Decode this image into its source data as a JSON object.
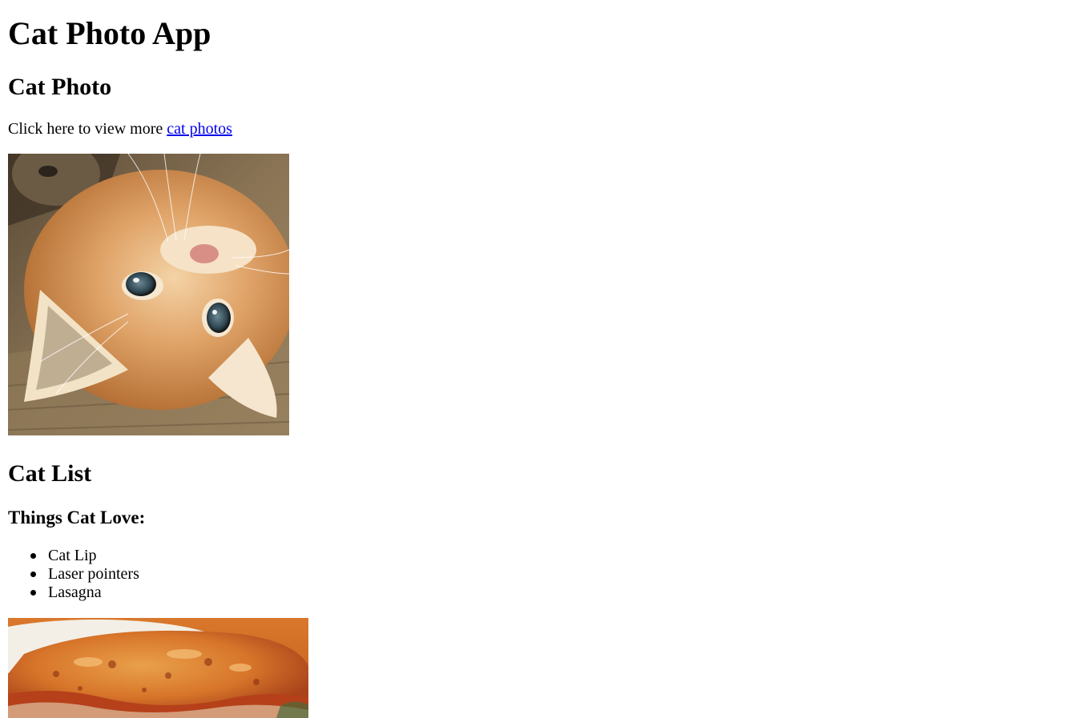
{
  "page": {
    "title": "Cat Photo App"
  },
  "photo_section": {
    "heading": "Cat Photo",
    "more_text": "Click here to view more ",
    "more_link": "cat photos",
    "image_icon": "kitten-photo"
  },
  "list_section": {
    "heading": "Cat List",
    "subheading": "Things Cat Love:",
    "items": [
      "Cat Lip",
      "Laser pointers",
      "Lasagna"
    ],
    "image_icon": "lasagna-photo"
  },
  "colors": {
    "link": "#0000ee",
    "text": "#000000",
    "background": "#ffffff"
  }
}
